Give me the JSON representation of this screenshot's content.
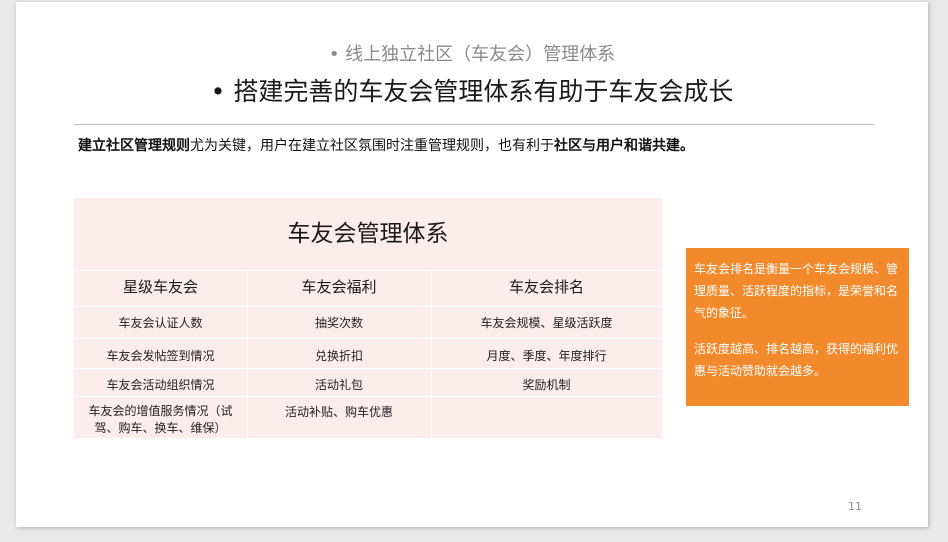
{
  "slide": {
    "subtitle": "• 线上独立社区（车友会）管理体系",
    "title": "• 搭建完善的车友会管理体系有助于车友会成长",
    "lead": {
      "bold1": "建立社区管理规则",
      "mid": "尤为关键，用户在建立社区氛围时注重管理规则，也有利于",
      "bold2": "社区与用户和谐共建。"
    },
    "table": {
      "title": "车友会管理体系",
      "headers": [
        "星级车友会",
        "车友会福利",
        "车友会排名"
      ],
      "rows": [
        [
          "车友会认证人数",
          "抽奖次数",
          "车友会规模、星级活跃度"
        ],
        [
          "车友会发帖签到情况",
          "兑换折扣",
          "月度、季度、年度排行"
        ],
        [
          "车友会活动组织情况",
          "活动礼包",
          "奖励机制"
        ],
        [
          "车友会的增值服务情况（试驾、购车、换车、维保）",
          "活动补贴、购车优惠",
          ""
        ]
      ]
    },
    "note": {
      "p1": "车友会排名是衡量一个车友会规模、管理质量、活跃程度的指标，是荣誉和名气的象征。",
      "p2": "活跃度越高、排名越高，获得的福利优惠与活动赞助就会越多。"
    },
    "page_number": "11",
    "colors": {
      "table_bg": "#fdecec",
      "note_bg": "#f28a2c"
    }
  }
}
